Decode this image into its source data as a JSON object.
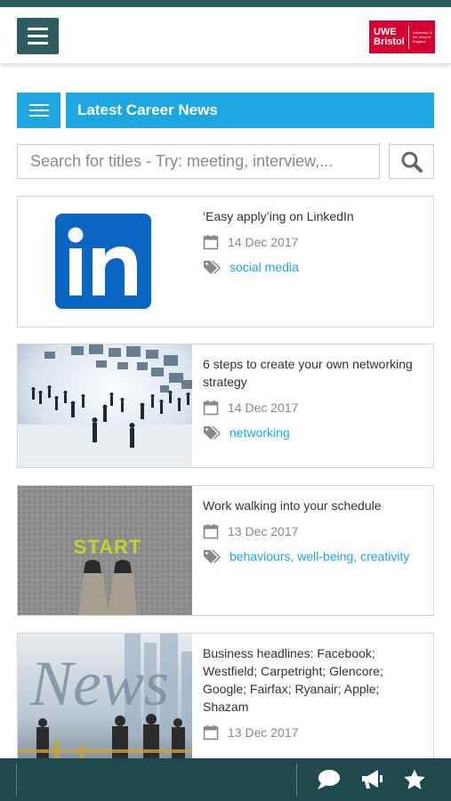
{
  "header": {
    "logo_main": "UWE\nBristol",
    "logo_small": "University of the West of England"
  },
  "section": {
    "title": "Latest Career News"
  },
  "search": {
    "placeholder": "Search for titles - Try: meeting, interview,..."
  },
  "articles": [
    {
      "title": "‘Easy apply’ing on LinkedIn",
      "date": "14 Dec 2017",
      "tags": "social media"
    },
    {
      "title": "6 steps to create your own networking strategy",
      "date": "14 Dec 2017",
      "tags": "networking"
    },
    {
      "title": "Work walking into your schedule",
      "date": "13 Dec 2017",
      "tags": "behaviours, well-being, creativity"
    },
    {
      "title": "Business headlines: Facebook; Westfield; Carpetright; Glencore; Google; Fairfax; Ryanair; Apple; Shazam",
      "date": "13 Dec 2017",
      "tags": ""
    }
  ],
  "thumbs": {
    "start_text": "START",
    "news_text": "News"
  },
  "colors": {
    "teal": "#2e5d60",
    "accent": "#1da6e0",
    "footer": "#1f4a4d",
    "brand_red": "#d50032"
  }
}
